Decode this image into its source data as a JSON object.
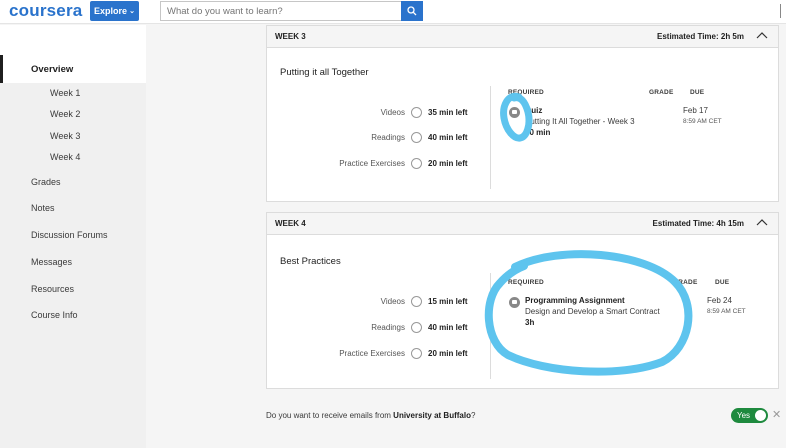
{
  "header": {
    "logo": "coursera",
    "explore_label": "Explore",
    "search_placeholder": "What do you want to learn?"
  },
  "sidebar": {
    "overview": "Overview",
    "weeks": [
      "Week 1",
      "Week 2",
      "Week 3",
      "Week 4"
    ],
    "items": [
      "Grades",
      "Notes",
      "Discussion Forums",
      "Messages",
      "Resources",
      "Course Info"
    ]
  },
  "week3": {
    "label": "WEEK 3",
    "estimated": "Estimated Time: 2h 5m",
    "title": "Putting it all Together",
    "rows": [
      {
        "label": "Videos",
        "time": "35 min left"
      },
      {
        "label": "Readings",
        "time": "40 min left"
      },
      {
        "label": "Practice Exercises",
        "time": "20 min left"
      }
    ],
    "col_required": "REQUIRED",
    "col_grade": "GRADE",
    "col_due": "DUE",
    "item_type": "Quiz",
    "item_name": "Putting It All Together - Week 3",
    "item_duration": "30 min",
    "due_date": "Feb 17",
    "due_time": "8:59 AM CET"
  },
  "week4": {
    "label": "WEEK 4",
    "estimated": "Estimated Time: 4h 15m",
    "title": "Best Practices",
    "rows": [
      {
        "label": "Videos",
        "time": "15 min left"
      },
      {
        "label": "Readings",
        "time": "40 min left"
      },
      {
        "label": "Practice Exercises",
        "time": "20 min left"
      }
    ],
    "col_required": "REQUIRED",
    "col_grade": "GRADE",
    "col_due": "DUE",
    "item_type": "Programming Assignment",
    "item_name": "Design and Develop a Smart Contract",
    "item_duration": "3h",
    "due_date": "Feb 24",
    "due_time": "8:59 AM CET"
  },
  "email": {
    "question_prefix": "Do you want to receive emails from ",
    "org": "University at Buffalo",
    "question_suffix": "?",
    "toggle_label": "Yes",
    "close": "✕"
  },
  "colors": {
    "brand": "#2a73cc",
    "toggle_on": "#1e8a3e",
    "annotation": "#5ec4ee"
  }
}
